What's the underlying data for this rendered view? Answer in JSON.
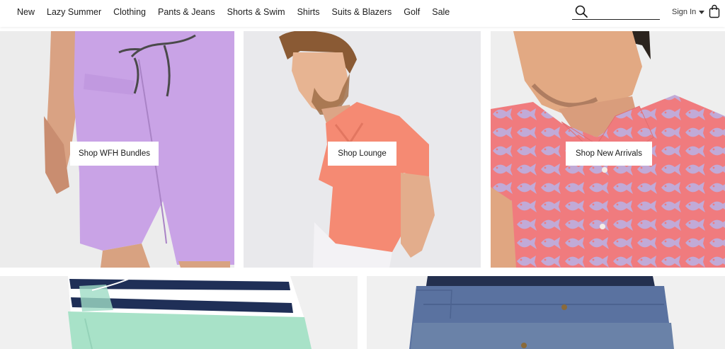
{
  "nav": {
    "items": [
      "New",
      "Lazy Summer",
      "Clothing",
      "Pants & Jeans",
      "Shorts & Swim",
      "Shirts",
      "Suits & Blazers",
      "Golf",
      "Sale"
    ],
    "search": {
      "value": "",
      "placeholder": ""
    },
    "signin_label": "Sign In",
    "icons": {
      "search": "search-icon",
      "caret": "chevron-down-icon",
      "bag": "shopping-bag-icon"
    }
  },
  "tiles": [
    {
      "cta": "Shop WFH Bundles"
    },
    {
      "cta": "Shop Lounge"
    },
    {
      "cta": "Shop New Arrivals"
    }
  ],
  "colors": {
    "purple_shorts": "#c9a3e6",
    "coral_tee": "#f58a73",
    "print_shirt": "#f07b7e",
    "navy_stripe": "#1f2f57",
    "mint": "#a8e2c8",
    "blue_chino": "#5a72a0"
  }
}
